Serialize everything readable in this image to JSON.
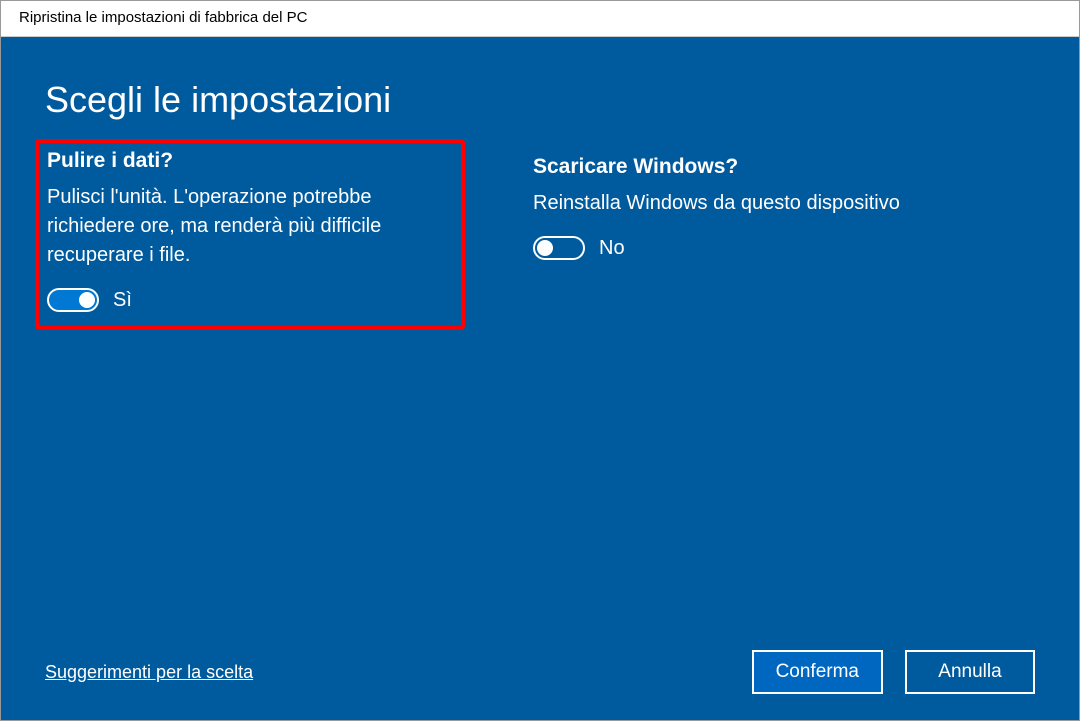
{
  "window": {
    "title": "Ripristina le impostazioni di fabbrica del PC"
  },
  "page": {
    "heading": "Scegli le impostazioni"
  },
  "options": {
    "clean_data": {
      "title": "Pulire i dati?",
      "description": "Pulisci l'unità. L'operazione potrebbe richiedere ore, ma renderà più difficile recuperare i file.",
      "toggle_state": "on",
      "toggle_label": "Sì",
      "highlighted": true
    },
    "download_windows": {
      "title": "Scaricare Windows?",
      "description": "Reinstalla Windows da questo dispositivo",
      "toggle_state": "off",
      "toggle_label": "No",
      "highlighted": false
    }
  },
  "footer": {
    "help_link": "Suggerimenti per la scelta",
    "confirm_label": "Conferma",
    "cancel_label": "Annulla"
  }
}
